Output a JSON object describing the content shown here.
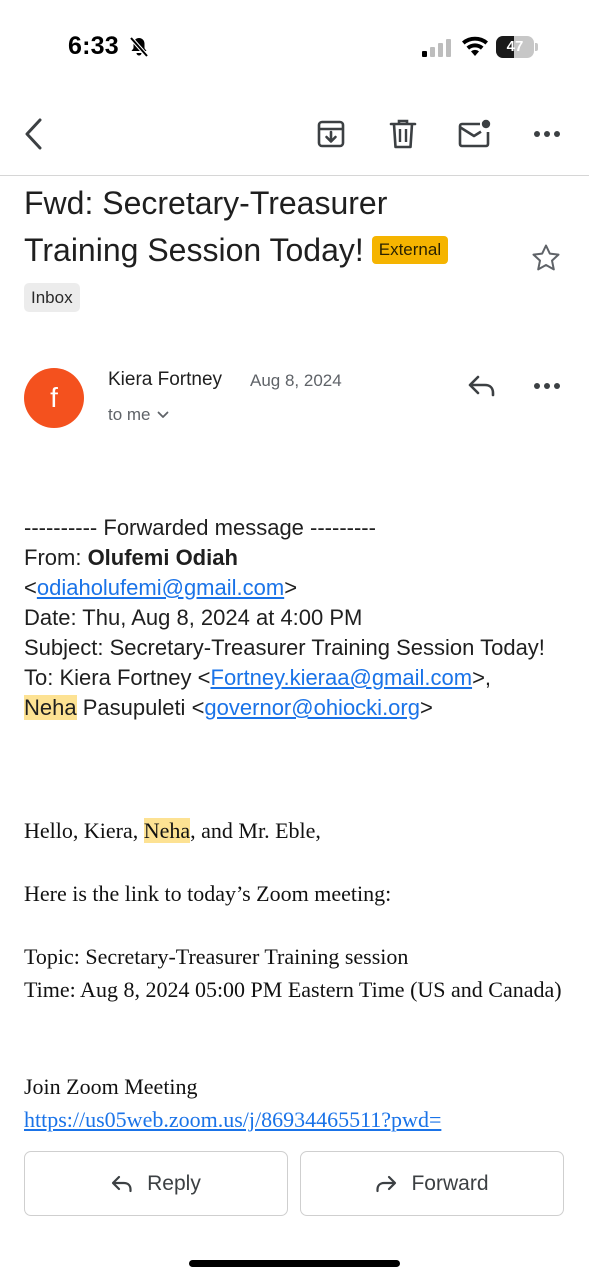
{
  "status_bar": {
    "time": "6:33",
    "battery": "47",
    "battery_level": 0.47,
    "icons": [
      "bell-slash-icon",
      "cellular-signal-icon",
      "wifi-icon",
      "battery-icon"
    ]
  },
  "toolbar": {
    "icons": [
      "back-arrow-icon",
      "archive-icon",
      "trash-icon",
      "mark-unread-icon",
      "more-horizontal-icon"
    ]
  },
  "email": {
    "subject": "Fwd: Secretary-Treasurer Training Session Today!",
    "external_label": "External",
    "external_color": "#f5b400",
    "label": "Inbox",
    "sender_name": "Kiera Fortney",
    "sender_initial": "f",
    "avatar_color": "#f4511e",
    "date": "Aug 8, 2024",
    "recipient": "to me"
  },
  "forwarded": {
    "header": "---------- Forwarded message ---------",
    "from_label": "From: ",
    "from_name": "Olufemi Odiah",
    "from_email": "odiaholufemi@gmail.com",
    "date_line": "Date: Thu, Aug 8, 2024 at 4:00 PM",
    "subject_line": "Subject: Secretary-Treasurer Training Session Today!",
    "to_label": "To: ",
    "to_name_1": "Kiera Fortney",
    "to_email_1": "Fortney.kieraa@gmail.com",
    "to_name_2_highlight": "Neha",
    "to_name_2_rest": " Pasupuleti",
    "to_email_2": "governor@ohiocki.org"
  },
  "body": {
    "greeting_start": "Hello, Kiera, ",
    "greeting_highlight": "Neha",
    "greeting_end": ", and Mr. Eble,",
    "intro": "Here is the link to today’s Zoom meeting:",
    "topic": "Topic: Secretary-Treasurer Training session",
    "time": "Time: Aug 8, 2024 05:00 PM Eastern Time (US and Canada)",
    "join": "Join Zoom Meeting",
    "zoom_link": "https://us05web.zoom.us/j/86934465511?pwd="
  },
  "actions": {
    "reply": "Reply",
    "forward": "Forward"
  },
  "colors": {
    "link": "#1a73e8",
    "highlight": "#fde293"
  }
}
